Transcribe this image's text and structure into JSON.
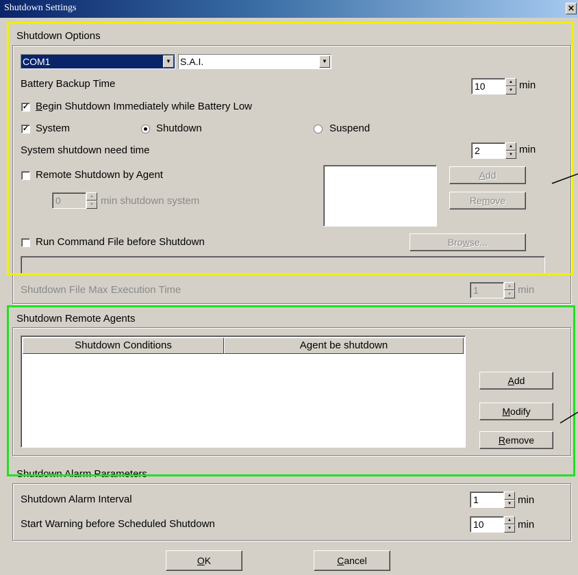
{
  "window": {
    "title": "Shutdown Settings",
    "close_glyph": "×"
  },
  "shutdown_options": {
    "group_title": "Shutdown Options",
    "port_select": "COM1",
    "ups_select": "S.A.I.",
    "battery_backup_label": "Battery Backup Time",
    "battery_backup_value": "10",
    "unit_min": "min",
    "begin_shutdown_label_first": "B",
    "begin_shutdown_label_rest": "egin Shutdown Immediately while Battery Low",
    "begin_shutdown_checked": true,
    "system_label": "System",
    "system_checked": true,
    "shutdown_radio_label": "Shutdown",
    "shutdown_radio_selected": true,
    "suspend_radio_label": "Suspend",
    "suspend_radio_selected": false,
    "system_need_time_label": "System shutdown need time",
    "system_need_time_value": "2",
    "remote_shutdown_label": "Remote Shutdown by Agent",
    "remote_shutdown_checked": false,
    "remote_minutes_value": "0",
    "remote_minutes_label": "min shutdown system",
    "add_label_first": "A",
    "add_label_rest": "dd",
    "remove_label_a": "Re",
    "remove_label_u": "m",
    "remove_label_b": "ove",
    "run_command_label": "Run Command File before Shutdown",
    "run_command_checked": false,
    "browse_label_a": "Bro",
    "browse_label_u": "w",
    "browse_label_b": "se...",
    "command_file_path": "",
    "max_exec_label": "Shutdown File Max Execution Time",
    "max_exec_value": "1"
  },
  "remote_agents": {
    "group_title": "Shutdown Remote Agents",
    "columns": [
      "Shutdown Conditions",
      "Agent be shutdown"
    ],
    "rows": [],
    "add_u": "A",
    "add_rest": "dd",
    "modify_u": "M",
    "modify_rest": "odify",
    "remove_u": "R",
    "remove_rest": "emove"
  },
  "alarm": {
    "group_title": "Shutdown Alarm Parameters",
    "interval_label": "Shutdown Alarm Interval",
    "interval_value": "1",
    "warning_label": "Start Warning before Scheduled Shutdown",
    "warning_value": "10"
  },
  "footer": {
    "ok_u": "O",
    "ok_rest": "K",
    "cancel_u": "C",
    "cancel_rest": "ancel"
  },
  "colors": {
    "highlight_yellow": "#f0f000",
    "highlight_green": "#22e022",
    "selection_blue": "#0a246a",
    "dialog_face": "#d4d0c8"
  }
}
